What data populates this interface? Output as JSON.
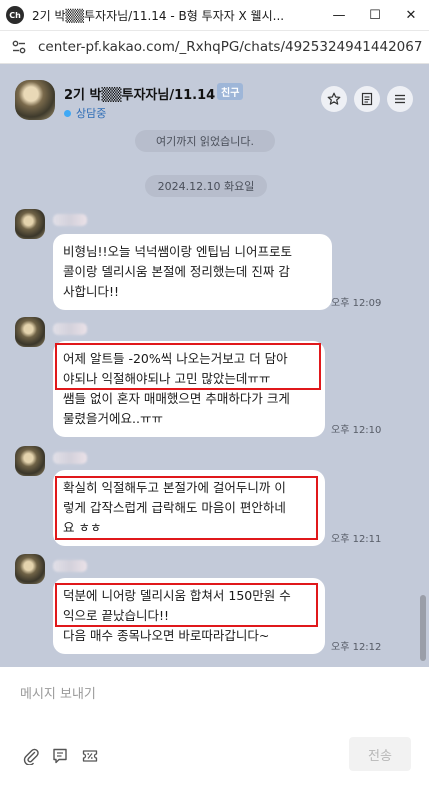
{
  "window": {
    "app_icon_text": "Ch",
    "title": "2기 박▒▒투자자님/11.14 - B형 투자자 X 웰시...",
    "minimize_glyph": "—",
    "maximize_glyph": "☐",
    "close_glyph": "✕"
  },
  "browser": {
    "url": "center-pf.kakao.com/_RxhqPG/chats/4925324941442067"
  },
  "header": {
    "name": "2기 박▒▒투자자님/11.14",
    "badge": "친구",
    "status": "상담중"
  },
  "chat": {
    "read_marker": "여기까지 읽었습니다.",
    "date_divider": "2024.12.10 화요일",
    "messages": [
      {
        "lines": [
          "비형님!!오늘 넉넉쌤이랑 엔팁님 니어프로토",
          "콜이랑 델리시움 본절에 정리했는데 진짜 감",
          "사합니다!!"
        ],
        "time": "오후 12:09",
        "highlighted": false
      },
      {
        "lines": [
          "어제 알트들 -20%씩 나오는거보고 더 담아",
          "야되나 익절해야되나 고민 많았는데ㅠㅠ",
          "쌤들 없이 혼자 매매했으면 추매하다가 크게",
          "물렸을거에요..ㅠㅠ"
        ],
        "time": "오후 12:10",
        "highlighted": true
      },
      {
        "lines": [
          "확실히 익절해두고 본절가에 걸어두니까 이",
          "렇게 갑작스럽게 급락해도 마음이 편안하네",
          "요 ㅎㅎ"
        ],
        "time": "오후 12:11",
        "highlighted": true
      },
      {
        "lines": [
          "덕분에 니어랑 델리시움 합쳐서 150만원 수",
          "익으로 끝났습니다!!",
          "다음 매수 종목나오면 바로따라갑니다~"
        ],
        "time": "오후 12:12",
        "highlighted": true
      }
    ]
  },
  "composer": {
    "placeholder": "메시지 보내기",
    "send_label": "전송"
  },
  "colors": {
    "chat_bg": "#c3cad9",
    "highlight_border": "#e0181b",
    "status_blue": "#3fa9f5",
    "badge_bg": "#9eb6d8"
  },
  "icons": [
    "star-icon",
    "document-icon",
    "menu-icon",
    "paperclip-icon",
    "quick-reply-icon",
    "coupon-icon"
  ]
}
